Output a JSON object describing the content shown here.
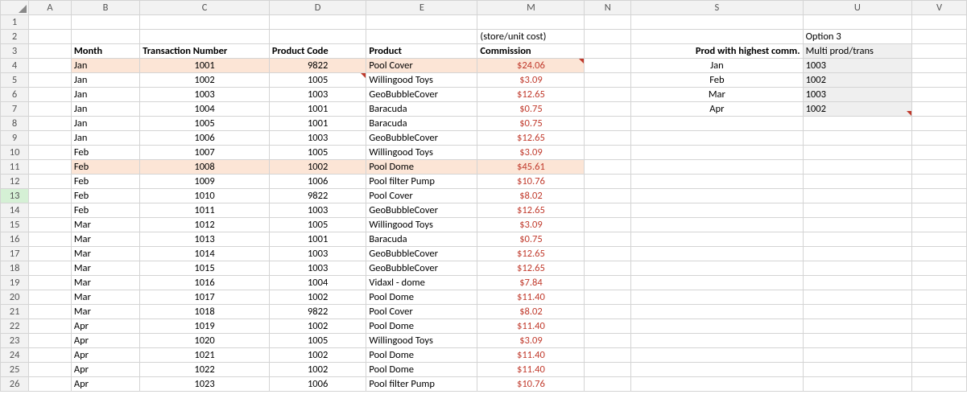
{
  "columns": [
    "A",
    "B",
    "C",
    "D",
    "E",
    "M",
    "N",
    "S",
    "U",
    "V"
  ],
  "row_headers": [
    1,
    2,
    3,
    4,
    5,
    6,
    7,
    8,
    9,
    10,
    11,
    12,
    13,
    14,
    15,
    16,
    17,
    18,
    19,
    20,
    21,
    22,
    23,
    24,
    25,
    26
  ],
  "selected_row": 13,
  "headers": {
    "month": "Month",
    "trans": "Transaction Number",
    "pcode": "Product Code",
    "product": "Product",
    "store_cost": "(store/unit cost)",
    "commission": "Commission",
    "prod_high": "Prod with highest comm.",
    "option3": "Option 3",
    "multi": "Multi prod/trans"
  },
  "rows": [
    {
      "r": 4,
      "month": "Jan",
      "trans": "1001",
      "pcode": "9822",
      "product": "Pool Cover",
      "comm": "$24.06",
      "hl": true
    },
    {
      "r": 5,
      "month": "Jan",
      "trans": "1002",
      "pcode": "1005",
      "product": "Willingood Toys",
      "comm": "$3.09"
    },
    {
      "r": 6,
      "month": "Jan",
      "trans": "1003",
      "pcode": "1003",
      "product": "GeoBubbleCover",
      "comm": "$12.65"
    },
    {
      "r": 7,
      "month": "Jan",
      "trans": "1004",
      "pcode": "1001",
      "product": "Baracuda",
      "comm": "$0.75"
    },
    {
      "r": 8,
      "month": "Jan",
      "trans": "1005",
      "pcode": "1001",
      "product": "Baracuda",
      "comm": "$0.75"
    },
    {
      "r": 9,
      "month": "Jan",
      "trans": "1006",
      "pcode": "1003",
      "product": "GeoBubbleCover",
      "comm": "$12.65"
    },
    {
      "r": 10,
      "month": "Feb",
      "trans": "1007",
      "pcode": "1005",
      "product": "Willingood Toys",
      "comm": "$3.09"
    },
    {
      "r": 11,
      "month": "Feb",
      "trans": "1008",
      "pcode": "1002",
      "product": "Pool Dome",
      "comm": "$45.61",
      "hl": true
    },
    {
      "r": 12,
      "month": "Feb",
      "trans": "1009",
      "pcode": "1006",
      "product": "Pool filter Pump",
      "comm": "$10.76"
    },
    {
      "r": 13,
      "month": "Feb",
      "trans": "1010",
      "pcode": "9822",
      "product": "Pool Cover",
      "comm": "$8.02"
    },
    {
      "r": 14,
      "month": "Feb",
      "trans": "1011",
      "pcode": "1003",
      "product": "GeoBubbleCover",
      "comm": "$12.65"
    },
    {
      "r": 15,
      "month": "Mar",
      "trans": "1012",
      "pcode": "1005",
      "product": "Willingood Toys",
      "comm": "$3.09"
    },
    {
      "r": 16,
      "month": "Mar",
      "trans": "1013",
      "pcode": "1001",
      "product": "Baracuda",
      "comm": "$0.75"
    },
    {
      "r": 17,
      "month": "Mar",
      "trans": "1014",
      "pcode": "1003",
      "product": "GeoBubbleCover",
      "comm": "$12.65"
    },
    {
      "r": 18,
      "month": "Mar",
      "trans": "1015",
      "pcode": "1003",
      "product": "GeoBubbleCover",
      "comm": "$12.65"
    },
    {
      "r": 19,
      "month": "Mar",
      "trans": "1016",
      "pcode": "1004",
      "product": "Vidaxl - dome",
      "comm": "$7.84"
    },
    {
      "r": 20,
      "month": "Mar",
      "trans": "1017",
      "pcode": "1002",
      "product": "Pool Dome",
      "comm": "$11.40"
    },
    {
      "r": 21,
      "month": "Mar",
      "trans": "1018",
      "pcode": "9822",
      "product": "Pool Cover",
      "comm": "$8.02"
    },
    {
      "r": 22,
      "month": "Apr",
      "trans": "1019",
      "pcode": "1002",
      "product": "Pool Dome",
      "comm": "$11.40"
    },
    {
      "r": 23,
      "month": "Apr",
      "trans": "1020",
      "pcode": "1005",
      "product": "Willingood Toys",
      "comm": "$3.09"
    },
    {
      "r": 24,
      "month": "Apr",
      "trans": "1021",
      "pcode": "1002",
      "product": "Pool Dome",
      "comm": "$11.40"
    },
    {
      "r": 25,
      "month": "Apr",
      "trans": "1022",
      "pcode": "1002",
      "product": "Pool Dome",
      "comm": "$11.40"
    },
    {
      "r": 26,
      "month": "Apr",
      "trans": "1023",
      "pcode": "1006",
      "product": "Pool filter Pump",
      "comm": "$10.76"
    }
  ],
  "summary": [
    {
      "r": 4,
      "month": "Jan",
      "code": "1003"
    },
    {
      "r": 5,
      "month": "Feb",
      "code": "1002"
    },
    {
      "r": 6,
      "month": "Mar",
      "code": "1003"
    },
    {
      "r": 7,
      "month": "Apr",
      "code": "1002"
    }
  ]
}
